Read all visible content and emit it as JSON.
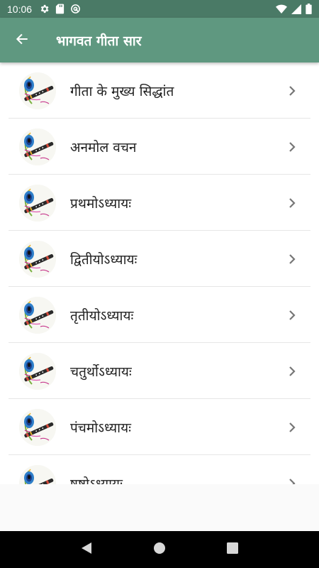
{
  "status_bar": {
    "time": "10:06",
    "left_icons": [
      "settings-icon",
      "sd-card-icon",
      "data-saver-icon"
    ],
    "right_icons": [
      "wifi-icon",
      "signal-icon",
      "battery-icon"
    ]
  },
  "app_bar": {
    "title": "भागवत गीता सार",
    "back_icon": "arrow-back-icon",
    "background": "#5f9880"
  },
  "list": {
    "items": [
      {
        "label": "गीता के मुख्य सिद्धांत",
        "icon": "peacock-feather-flute-icon"
      },
      {
        "label": "अनमोल वचन",
        "icon": "peacock-feather-flute-icon"
      },
      {
        "label": "प्रथमोऽध्यायः",
        "icon": "peacock-feather-flute-icon"
      },
      {
        "label": "द्वितीयोऽध्यायः",
        "icon": "peacock-feather-flute-icon"
      },
      {
        "label": "तृतीयोऽध्यायः",
        "icon": "peacock-feather-flute-icon"
      },
      {
        "label": "चतुर्थोऽध्यायः",
        "icon": "peacock-feather-flute-icon"
      },
      {
        "label": "पंचमोऽध्यायः",
        "icon": "peacock-feather-flute-icon"
      },
      {
        "label": "षष्ठोऽध्यायः",
        "icon": "peacock-feather-flute-icon"
      }
    ]
  },
  "nav_bar": {
    "buttons": [
      "back-triangle-icon",
      "home-circle-icon",
      "recents-square-icon"
    ]
  },
  "colors": {
    "status_bar": "#4a7a66",
    "accent": "#5f9880"
  }
}
